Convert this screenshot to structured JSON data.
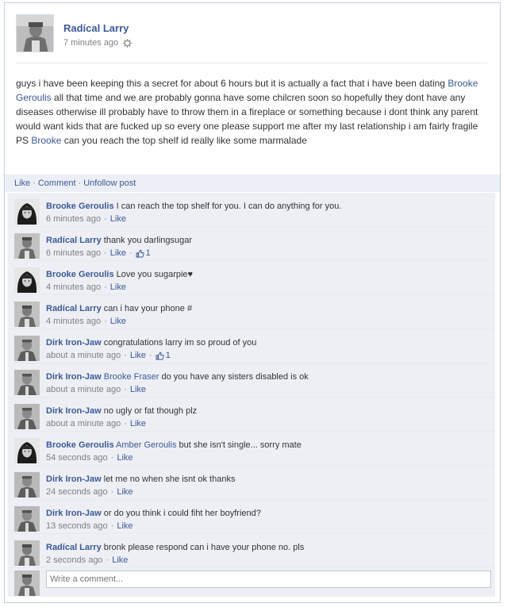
{
  "post": {
    "author": "Radícal Larry",
    "time": "7 minutes ago",
    "body_part1": "guys i have been keeping this a secret for about 6 hours but it is actually a fact that i have been dating ",
    "mention1": "Brooke Geroulis",
    "body_part2": " all that time and we are probably gonna have some chilcren soon so hopefully they dont have any diseases otherwise ill probably have to throw them in a fireplace or something because i dont think any parent would want kids that are fucked up so every one please support me after my last relationship i am fairly fragile PS ",
    "mention2": "Brooke",
    "body_part3": " can you reach the top shelf id really like some marmalade"
  },
  "actions": {
    "like": "Like",
    "comment": "Comment",
    "unfollow": "Unfollow post"
  },
  "comments": [
    {
      "name": "Brooke Geroulis",
      "mention": "",
      "text": "I can reach the top shelf for you. I can do anything for you.",
      "time": "6 minutes ago",
      "like": "Like",
      "likes": "",
      "avatar": "girl"
    },
    {
      "name": "Radícal Larry",
      "mention": "",
      "text": "thank you darlingsugar",
      "time": "6 minutes ago",
      "like": "Like",
      "likes": "1",
      "avatar": "larry"
    },
    {
      "name": "Brooke Geroulis",
      "mention": "",
      "text": "Love you sugarpie♥",
      "time": "4 minutes ago",
      "like": "Like",
      "likes": "",
      "avatar": "girl"
    },
    {
      "name": "Radícal Larry",
      "mention": "",
      "text": "can i hav your phone #",
      "time": "4 minutes ago",
      "like": "Like",
      "likes": "",
      "avatar": "larry"
    },
    {
      "name": "Dirk Iron-Jaw",
      "mention": "",
      "text": "congratulations larry im so proud of you",
      "time": "about a minute ago",
      "like": "Like",
      "likes": "1",
      "avatar": "dirk"
    },
    {
      "name": "Dirk Iron-Jaw",
      "mention": "Brooke Fraser",
      "text": "do you have any sisters disabled is ok",
      "time": "about a minute ago",
      "like": "Like",
      "likes": "",
      "avatar": "dirk"
    },
    {
      "name": "Dirk Iron-Jaw",
      "mention": "",
      "text": "no ugly or fat though plz",
      "time": "about a minute ago",
      "like": "Like",
      "likes": "",
      "avatar": "dirk"
    },
    {
      "name": "Brooke Geroulis",
      "mention": "Amber Geroulis",
      "text": "but she isn't single... sorry mate",
      "time": "54 seconds ago",
      "like": "Like",
      "likes": "",
      "avatar": "girl"
    },
    {
      "name": "Dirk Iron-Jaw",
      "mention": "",
      "text": "let me no when she isnt ok thanks",
      "time": "24 seconds ago",
      "like": "Like",
      "likes": "",
      "avatar": "dirk"
    },
    {
      "name": "Dirk Iron-Jaw",
      "mention": "",
      "text": "or do you think i could fiht her boyfriend?",
      "time": "13 seconds ago",
      "like": "Like",
      "likes": "",
      "avatar": "dirk"
    },
    {
      "name": "Radícal Larry",
      "mention": "",
      "text": "bronk please respond can i have your phone no. pls",
      "time": "2 seconds ago",
      "like": "Like",
      "likes": "",
      "avatar": "larry"
    }
  ],
  "composer": {
    "placeholder": "Write a comment..."
  }
}
